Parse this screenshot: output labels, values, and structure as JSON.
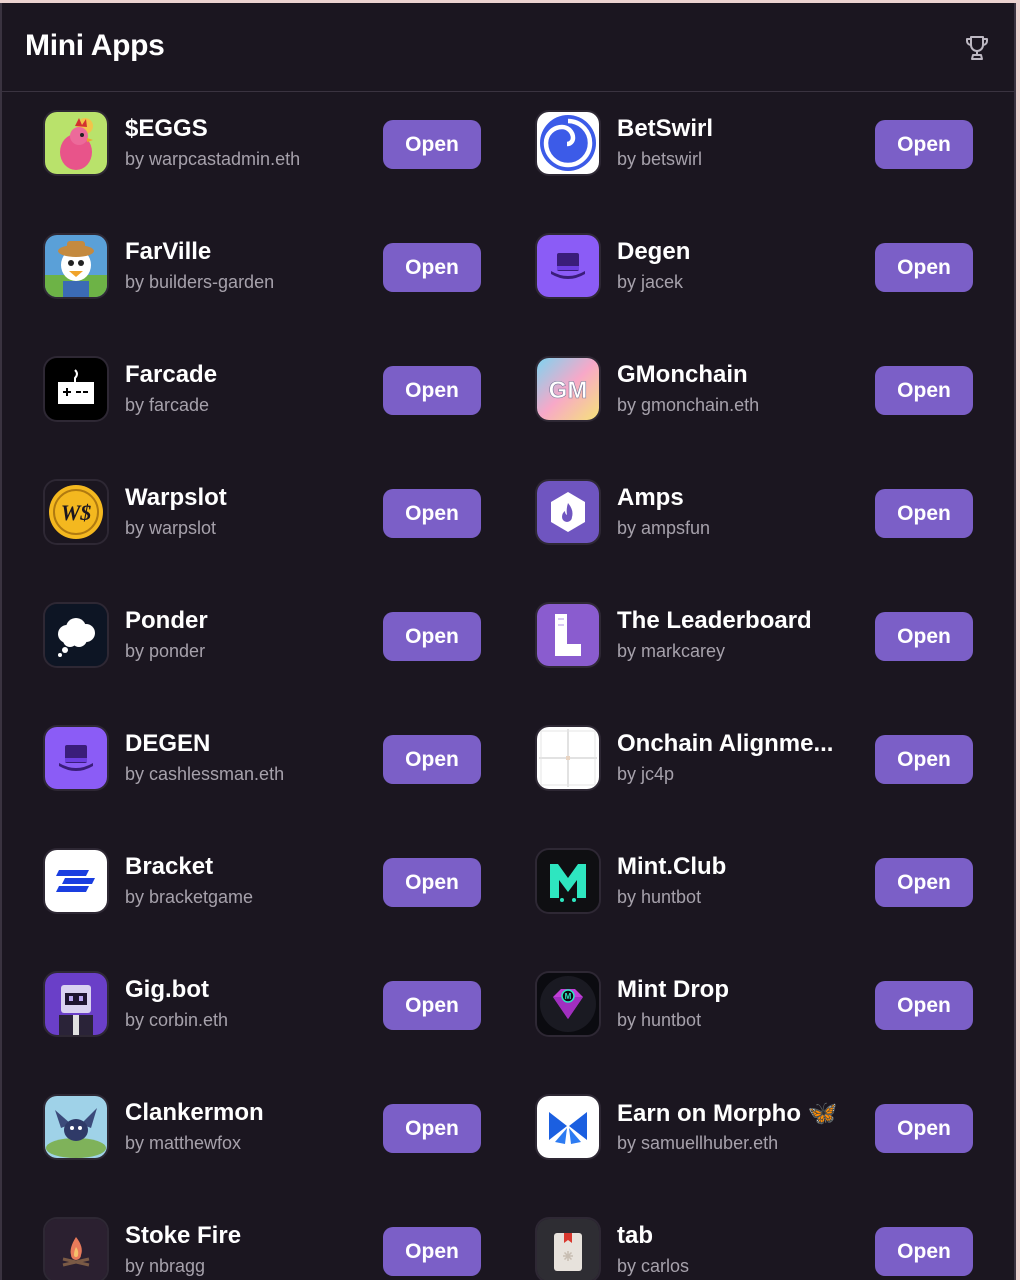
{
  "header": {
    "title": "Mini Apps",
    "icon": "trophy-icon"
  },
  "apps": [
    {
      "name": "$EGGS",
      "author": "by warpcastadmin.eth",
      "icon": "rooster-icon",
      "button": "Open"
    },
    {
      "name": "BetSwirl",
      "author": "by betswirl",
      "icon": "swirl-icon",
      "button": "Open"
    },
    {
      "name": "FarVille",
      "author": "by builders-garden",
      "icon": "duck-farmer-icon",
      "button": "Open"
    },
    {
      "name": "Degen",
      "author": "by jacek",
      "icon": "top-hat-icon",
      "button": "Open"
    },
    {
      "name": "Farcade",
      "author": "by farcade",
      "icon": "arcade-controller-icon",
      "button": "Open"
    },
    {
      "name": "GMonchain",
      "author": "by gmonchain.eth",
      "icon": "gm-gradient-icon",
      "button": "Open"
    },
    {
      "name": "Warpslot",
      "author": "by warpslot",
      "icon": "coin-icon",
      "button": "Open"
    },
    {
      "name": "Amps",
      "author": "by ampsfun",
      "icon": "hexagon-flame-icon",
      "button": "Open"
    },
    {
      "name": "Ponder",
      "author": "by ponder",
      "icon": "thought-cloud-icon",
      "button": "Open"
    },
    {
      "name": "The Leaderboard",
      "author": "by markcarey",
      "icon": "letter-l-icon",
      "button": "Open"
    },
    {
      "name": "DEGEN",
      "author": "by cashlessman.eth",
      "icon": "top-hat-icon",
      "button": "Open"
    },
    {
      "name": "Onchain Alignme...",
      "author": "by jc4p",
      "icon": "grid-square-icon",
      "button": "Open"
    },
    {
      "name": "Bracket",
      "author": "by bracketgame",
      "icon": "bracket-icon",
      "button": "Open"
    },
    {
      "name": "Mint.Club",
      "author": "by huntbot",
      "icon": "letter-m-icon",
      "button": "Open"
    },
    {
      "name": "Gig.bot",
      "author": "by corbin.eth",
      "icon": "robot-icon",
      "button": "Open"
    },
    {
      "name": "Mint Drop",
      "author": "by huntbot",
      "icon": "gem-icon",
      "button": "Open"
    },
    {
      "name": "Clankermon",
      "author": "by matthewfox",
      "icon": "dragon-icon",
      "button": "Open"
    },
    {
      "name": "Earn on Morpho 🦋",
      "author": "by samuellhuber.eth",
      "icon": "butterfly-icon",
      "button": "Open"
    },
    {
      "name": "Stoke Fire",
      "author": "by nbragg",
      "icon": "campfire-icon",
      "button": "Open"
    },
    {
      "name": "tab",
      "author": "by carlos",
      "icon": "tab-card-icon",
      "button": "Open"
    }
  ]
}
